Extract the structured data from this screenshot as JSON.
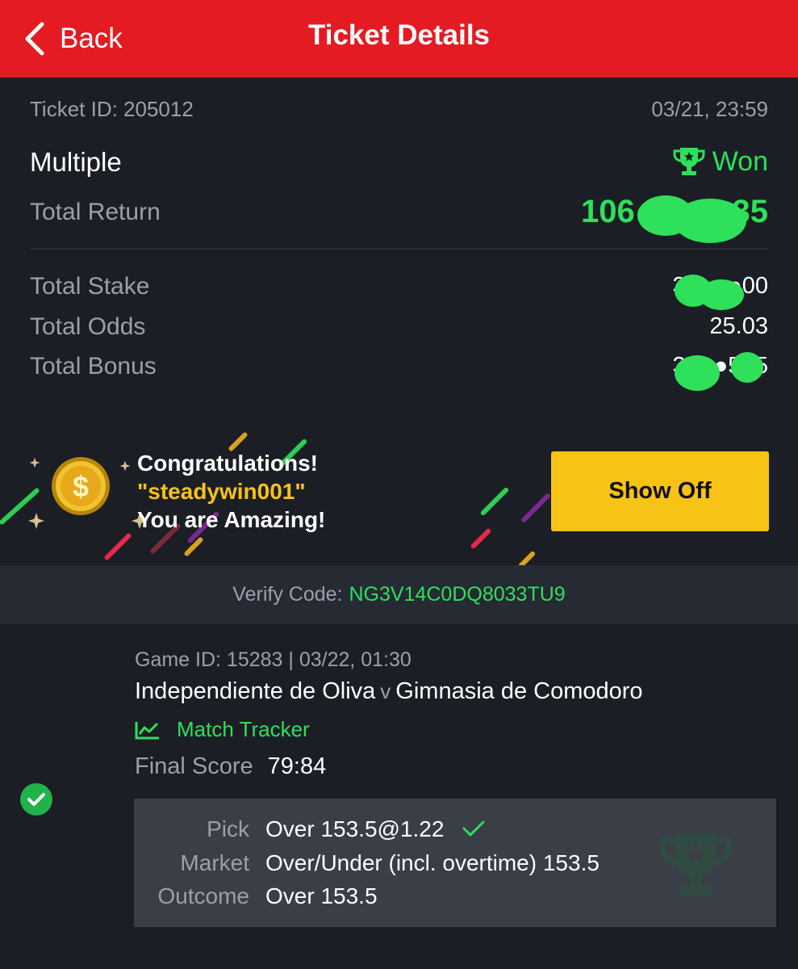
{
  "header": {
    "back_label": "Back",
    "title": "Ticket Details"
  },
  "ticket": {
    "id_text": "Ticket ID: 205012",
    "datetime": "03/21, 23:59",
    "type": "Multiple",
    "status": "Won",
    "total_return_label": "Total Return",
    "total_return_value": "106●●●●●35",
    "total_stake_label": "Total Stake",
    "total_stake_value": "3●●●●00",
    "total_odds_label": "Total Odds",
    "total_odds_value": "25.03",
    "total_bonus_label": "Total Bonus",
    "total_bonus_value": "3●●●5●5"
  },
  "congrats": {
    "line1": "Congratulations!",
    "username": "\"steadywin001\"",
    "line3": "You are Amazing!",
    "show_off_label": "Show Off"
  },
  "verify": {
    "label": "Verify Code:",
    "code": "NG3V14C0DQ8033TU9"
  },
  "game": {
    "id_line": "Game ID: 15283 | 03/22, 01:30",
    "home": "Independiente de Oliva",
    "vs": "v",
    "away": "Gimnasia de Comodoro",
    "tracker_label": "Match Tracker",
    "final_score_label": "Final Score",
    "final_score": "79:84",
    "pick_label": "Pick",
    "pick_value": "Over 153.5@1.22",
    "market_label": "Market",
    "market_value": "Over/Under (incl. overtime) 153.5",
    "outcome_label": "Outcome",
    "outcome_value": "Over 153.5"
  },
  "colors": {
    "header_red": "#e41b23",
    "win_green": "#2ee05a",
    "button_yellow": "#f7c316",
    "background": "#1b1e25"
  },
  "icons": [
    "chevron-left-icon",
    "trophy-icon",
    "coin-icon",
    "chart-line-icon",
    "check-circle-icon",
    "check-icon",
    "trophy-watermark-icon"
  ]
}
